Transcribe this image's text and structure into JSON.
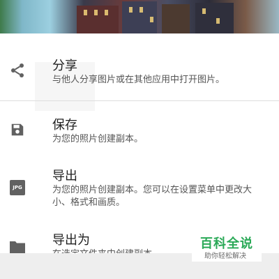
{
  "menu": {
    "items": [
      {
        "icon": "share-icon",
        "title": "分享",
        "description": "与他人分享图片或在其他应用中打开图片。"
      },
      {
        "icon": "save-icon",
        "title": "保存",
        "description": "为您的照片创建副本。"
      },
      {
        "icon": "jpg-file-icon",
        "icon_text": "JPG",
        "title": "导出",
        "description": "为您的照片创建副本。您可以在设置菜单中更改大小、格式和画质。"
      },
      {
        "icon": "folder-icon",
        "title": "导出为",
        "description": "在选定文件夹中创建副本。"
      }
    ]
  },
  "watermark": {
    "title": "百科全说",
    "subtitle": "助你轻松解决"
  },
  "colors": {
    "icon_gray": "#616161",
    "watermark_green": "#2aa957",
    "sheet_background": "#ffffff"
  }
}
